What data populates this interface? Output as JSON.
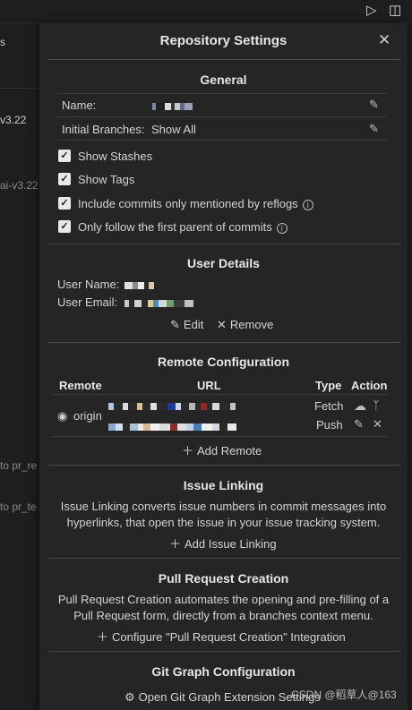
{
  "background": {
    "left_fragments": [
      "s",
      "v3.22",
      "ai-v3.22",
      "to pr_re",
      "to pr_te"
    ]
  },
  "dialog": {
    "title": "Repository Settings",
    "general": {
      "title": "General",
      "name_label": "Name:",
      "initial_branches_label": "Initial Branches:",
      "initial_branches_value": "Show All",
      "checkboxes": [
        {
          "label": "Show Stashes",
          "checked": true,
          "info": false
        },
        {
          "label": "Show Tags",
          "checked": true,
          "info": false
        },
        {
          "label": "Include commits only mentioned by reflogs",
          "checked": true,
          "info": true
        },
        {
          "label": "Only follow the first parent of commits",
          "checked": true,
          "info": true
        }
      ]
    },
    "user_details": {
      "title": "User Details",
      "user_name_label": "User Name:",
      "user_email_label": "User Email:",
      "edit_label": "Edit",
      "remove_label": "Remove"
    },
    "remote_configuration": {
      "title": "Remote Configuration",
      "headers": {
        "remote": "Remote",
        "url": "URL",
        "type": "Type",
        "action": "Action"
      },
      "remote_name": "origin",
      "fetch_label": "Fetch",
      "push_label": "Push",
      "add_label": "Add Remote"
    },
    "issue_linking": {
      "title": "Issue Linking",
      "description": "Issue Linking converts issue numbers in commit messages into hyperlinks, that open the issue in your issue tracking system.",
      "add_label": "Add Issue Linking"
    },
    "pull_request": {
      "title": "Pull Request Creation",
      "description": "Pull Request Creation automates the opening and pre-filling of a Pull Request form, directly from a branches context menu.",
      "configure_label": "Configure \"Pull Request Creation\" Integration"
    },
    "git_graph": {
      "title": "Git Graph Configuration",
      "open_label": "Open Git Graph Extension Settings"
    }
  },
  "watermark": "CSDN @稻草人@163",
  "colors": {
    "dialog_bg": "#252526",
    "page_bg": "#1e1e1e",
    "checkbox": "#e8e8e8"
  }
}
